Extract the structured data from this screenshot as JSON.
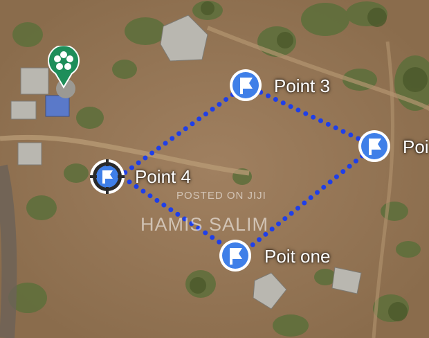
{
  "map": {
    "type": "satellite",
    "markers": [
      {
        "id": "point-3",
        "label": "Point 3",
        "icon": "flag-pin-icon"
      },
      {
        "id": "point-partial",
        "label": "Poi",
        "icon": "flag-pin-icon"
      },
      {
        "id": "point-4",
        "label": "Point 4",
        "icon": "crosshair-flag-pin-icon"
      },
      {
        "id": "poit-one",
        "label": "Poit one",
        "icon": "flag-pin-icon"
      }
    ],
    "place_marker": {
      "icon": "flower-place-icon",
      "color": "#1e8e5a"
    },
    "route": {
      "style": "dotted",
      "color": "#1f3fe8",
      "closed": true
    },
    "pin_color": "#3f7fe8"
  },
  "watermark": {
    "line1": "POSTED ON JIJI",
    "line2": "HAMIS SALIM"
  }
}
